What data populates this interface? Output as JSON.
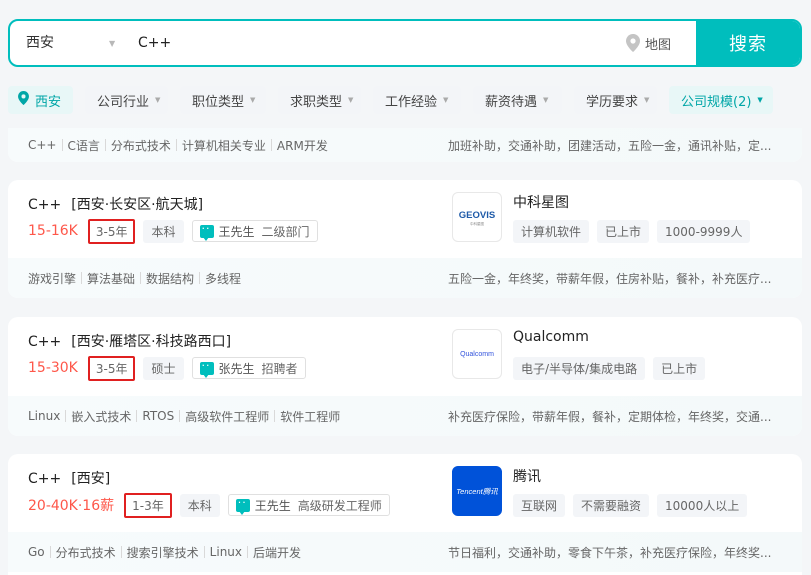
{
  "search": {
    "city": "西安",
    "query": "C++",
    "map_label": "地图",
    "button_label": "搜索"
  },
  "filters": {
    "location": "西安",
    "items": [
      "公司行业",
      "职位类型",
      "求职类型",
      "工作经验",
      "薪资待遇",
      "学历要求"
    ],
    "company_size": "公司规模(2)"
  },
  "partial_card": {
    "skills": [
      "C++",
      "C语言",
      "分布式技术",
      "计算机相关专业",
      "ARM开发"
    ],
    "welfare": "加班补助，交通补助，团建活动，五险一金，通讯补贴，定..."
  },
  "jobs": [
    {
      "title": "C++",
      "area": "[西安·长安区·航天城]",
      "salary": "15-16K",
      "experience": "3-5年",
      "degree": "本科",
      "recruiter": "王先生",
      "recruiter_role": "二级部门",
      "company": "中科星图",
      "logo_text": "GEOVIS",
      "company_tags": [
        "计算机软件",
        "已上市",
        "1000-9999人"
      ],
      "skills": [
        "游戏引擎",
        "算法基础",
        "数据结构",
        "多线程"
      ],
      "welfare": "五险一金，年终奖，带薪年假，住房补贴，餐补，补充医疗..."
    },
    {
      "title": "C++",
      "area": "[西安·雁塔区·科技路西口]",
      "salary": "15-30K",
      "experience": "3-5年",
      "degree": "硕士",
      "recruiter": "张先生",
      "recruiter_role": "招聘者",
      "company": "Qualcomm",
      "logo_text": "Qualcomm",
      "company_tags": [
        "电子/半导体/集成电路",
        "已上市"
      ],
      "skills": [
        "Linux",
        "嵌入式技术",
        "RTOS",
        "高级软件工程师",
        "软件工程师"
      ],
      "welfare": "补充医疗保险，带薪年假，餐补，定期体检，年终奖，交通..."
    },
    {
      "title": "C++",
      "area": "[西安]",
      "salary": "20-40K·16薪",
      "experience": "1-3年",
      "degree": "本科",
      "recruiter": "王先生",
      "recruiter_role": "高级研发工程师",
      "company": "腾讯",
      "logo_text": "Tencent腾讯",
      "company_tags": [
        "互联网",
        "不需要融资",
        "10000人以上"
      ],
      "skills": [
        "Go",
        "分布式技术",
        "搜索引擎技术",
        "Linux",
        "后端开发"
      ],
      "welfare": "节日福利，交通补助，零食下午茶，补充医疗保险，年终奖..."
    }
  ],
  "colors": {
    "accent": "#00bebd",
    "salary": "#fe574a",
    "highlight_box": "#e02020"
  },
  "icons": [
    "location-pin-icon",
    "map-pin-icon",
    "chat-icon",
    "chevron-down-icon"
  ]
}
